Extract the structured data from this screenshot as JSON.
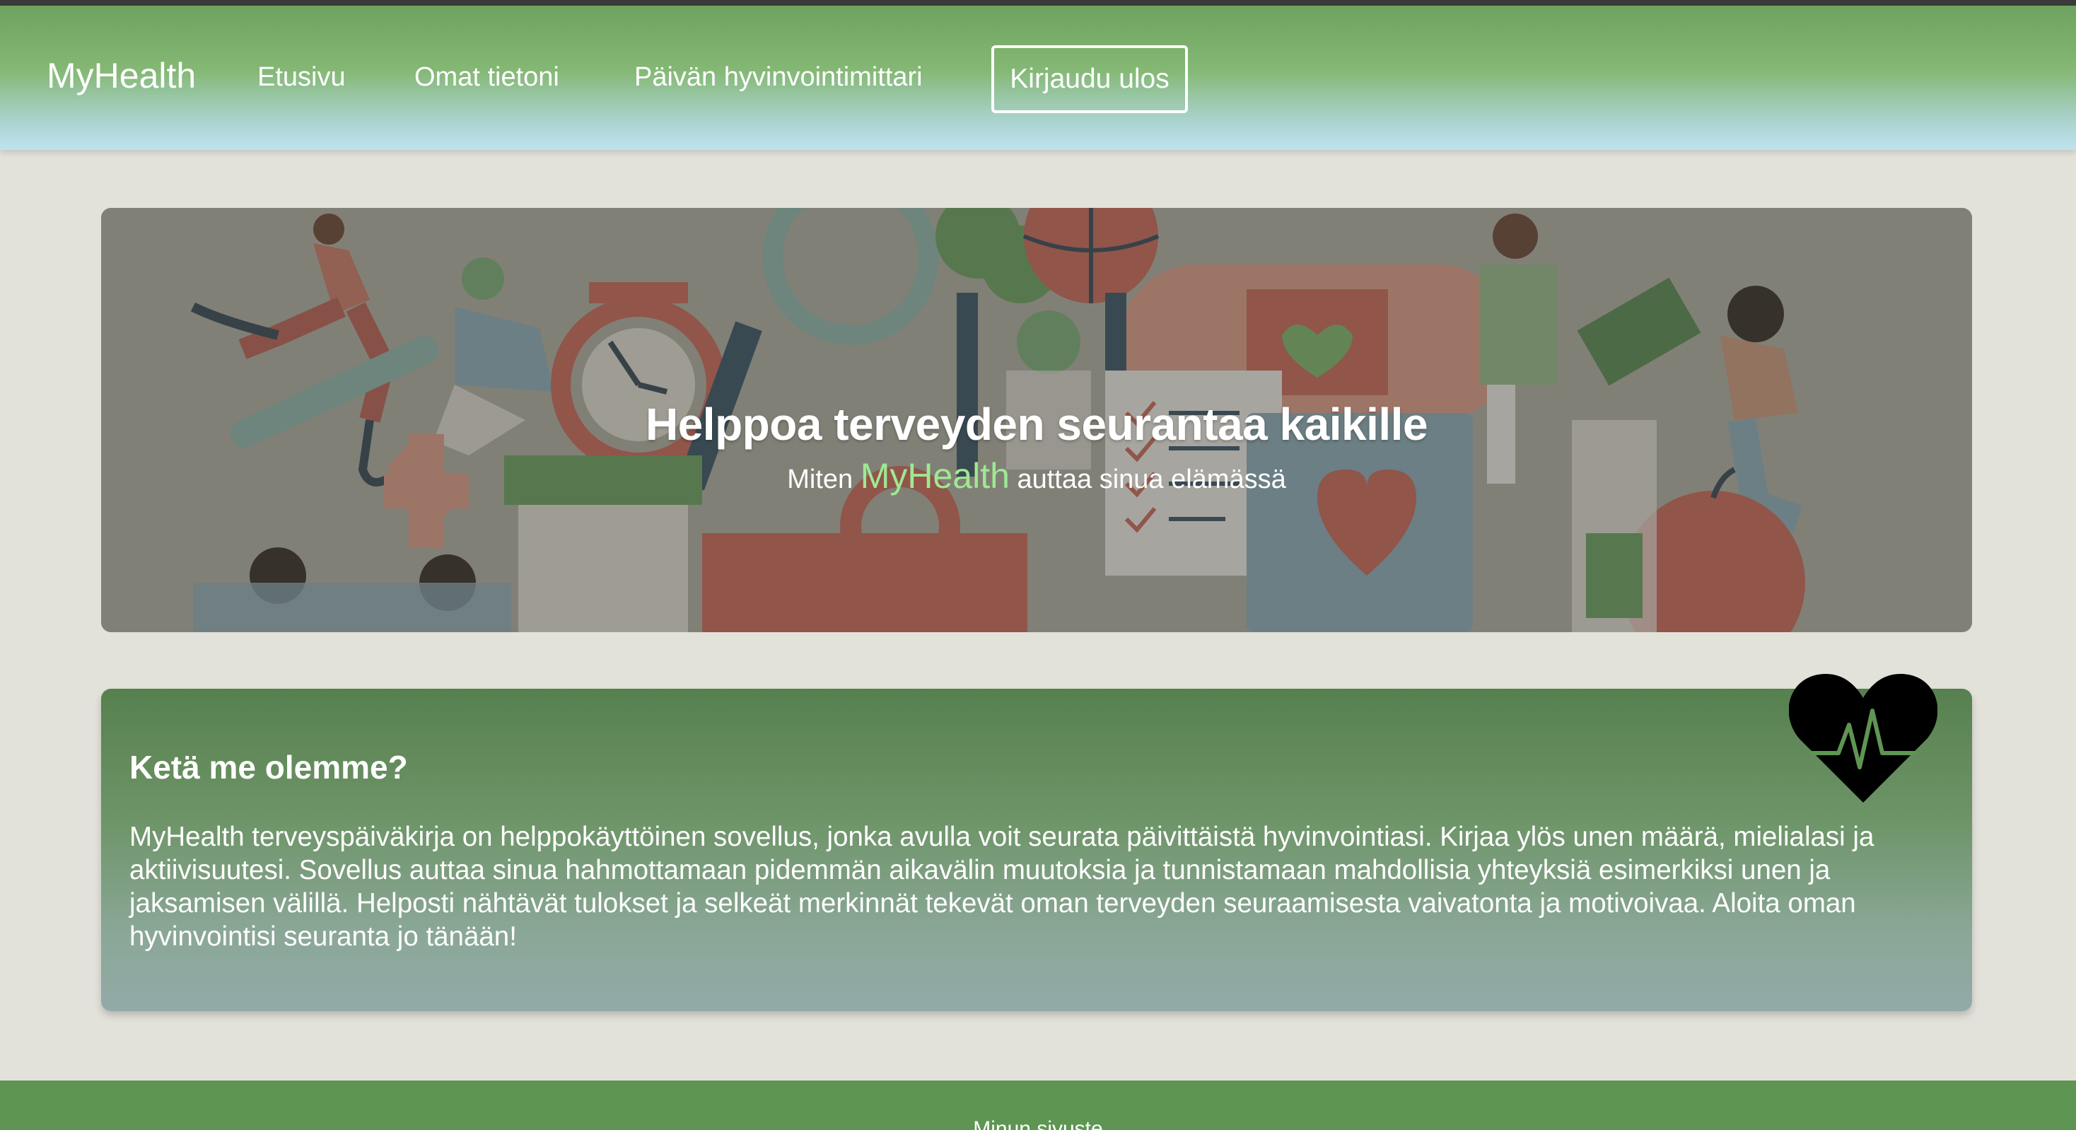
{
  "nav": {
    "brand": "MyHealth",
    "links": [
      "Etusivu",
      "Omat tietoni",
      "Päivän hyvinvointimittari"
    ],
    "logout": "Kirjaudu ulos"
  },
  "hero": {
    "title": "Helppoa terveyden seurantaa kaikille",
    "subtitle_pre": "Miten ",
    "subtitle_brand": "MyHealth",
    "subtitle_post": " auttaa sinua elämässä"
  },
  "about": {
    "title": "Ketä me olemme?",
    "text": "MyHealth terveyspäiväkirja on helppokäyttöinen sovellus, jonka avulla voit seurata päivittäistä hyvinvointiasi. Kirjaa ylös unen määrä, mielialasi ja aktiivisuutesi. Sovellus auttaa sinua hahmottamaan pidemmän aikavälin muutoksia ja tunnistamaan mahdollisia yhteyksiä esimerkiksi unen ja jaksamisen välillä. Helposti nähtävät tulokset ja selkeät merkinnät tekevät oman terveyden seuraamisesta vaivatonta ja motivoivaa. Aloita oman hyvinvointisi seuranta jo tänään!"
  },
  "footer": {
    "text": "Minun sivuste"
  },
  "colors": {
    "nav_top": "#6ea35f",
    "nav_bottom": "#bfe3ef",
    "page_bg": "#e2e1da",
    "card_top": "#57804f",
    "card_bottom": "#92aaa8",
    "brand_accent": "#9fe893",
    "footer": "#5f9553"
  }
}
